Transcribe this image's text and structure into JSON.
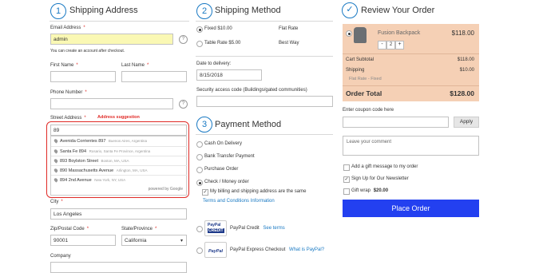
{
  "shipping_address": {
    "step": "1",
    "title": "Shipping Address",
    "email_label": "Email Address",
    "email_value": "admin",
    "email_note": "You can create an account after checkout.",
    "first_name_label": "First Name",
    "last_name_label": "Last Name",
    "phone_label": "Phone Number",
    "street_label": "Street Address",
    "suggestion_label": "Address suggestion",
    "street_value": "89",
    "suggestions": [
      {
        "bold": "Avenida Corrientes 897",
        "sub": "Buenos Aires, Argentina"
      },
      {
        "bold": "Santa Fe 894",
        "sub": "Rosario, Santa Fe Province, Argentina"
      },
      {
        "bold": "893 Boylston Street",
        "sub": "Boston, MA, USA"
      },
      {
        "bold": "890 Massachusetts Avenue",
        "sub": "Arlington, MA, USA"
      },
      {
        "bold": "894 2nd Avenue",
        "sub": "New York, NY, USA"
      }
    ],
    "powered_by": "powered by Google",
    "city_label": "City",
    "city_value": "Los Angeles",
    "zip_label": "Zip/Postal Code",
    "zip_value": "90001",
    "state_label": "State/Province",
    "state_value": "California",
    "company_label": "Company",
    "help_icon": "?"
  },
  "shipping_method": {
    "step": "2",
    "title": "Shipping Method",
    "options": [
      {
        "label": "Fixed $10.00",
        "carrier": "Flat Rate",
        "selected": true
      },
      {
        "label": "Table Rate $5.00",
        "carrier": "Best Way",
        "selected": false
      }
    ],
    "date_label": "Date to delivery:",
    "date_value": "8/15/2018",
    "security_label": "Security access code (Buildings/gated communities)"
  },
  "payment_method": {
    "step": "3",
    "title": "Payment Method",
    "options": [
      "Cash On Delivery",
      "Bank Transfer Payment",
      "Purchase Order",
      "Check / Money order"
    ],
    "same_address_label": "My billing and shipping address are the same",
    "terms_link": "Terms and Conditions Information",
    "paypal_credit_label": "PayPal Credit",
    "paypal_credit_link": "See terms",
    "paypal_express_label": "PayPal Express Checkout",
    "paypal_express_link": "What is PayPal?",
    "paypal_logo_text": "PayPal",
    "paypal_credit_text": "CREDIT"
  },
  "review": {
    "title": "Review Your Order",
    "product_name": "Fusion Backpack",
    "product_price": "$118.00",
    "qty": "2",
    "minus": "-",
    "plus": "+",
    "cart_subtotal_label": "Cart Subtotal",
    "cart_subtotal_value": "$118.00",
    "shipping_label": "Shipping",
    "shipping_value": "$10.00",
    "shipping_sub": "Flat Rate - Fixed",
    "order_total_label": "Order Total",
    "order_total_value": "$128.00",
    "coupon_label": "Enter coupon code here",
    "apply_label": "Apply",
    "comment_placeholder": "Leave your comment",
    "gift_message_label": "Add a gift message to my order",
    "newsletter_label": "Sign Up for Our Newsletter",
    "gift_wrap_label": "Gift wrap",
    "gift_wrap_price": "$20.00",
    "place_order_label": "Place Order"
  },
  "colors": {
    "accent": "#1979c3",
    "summary_bg": "#f5d0b5",
    "email_bg": "#faf8b4",
    "place_order_bg": "#2340f0",
    "highlight_red": "#e02b27"
  }
}
